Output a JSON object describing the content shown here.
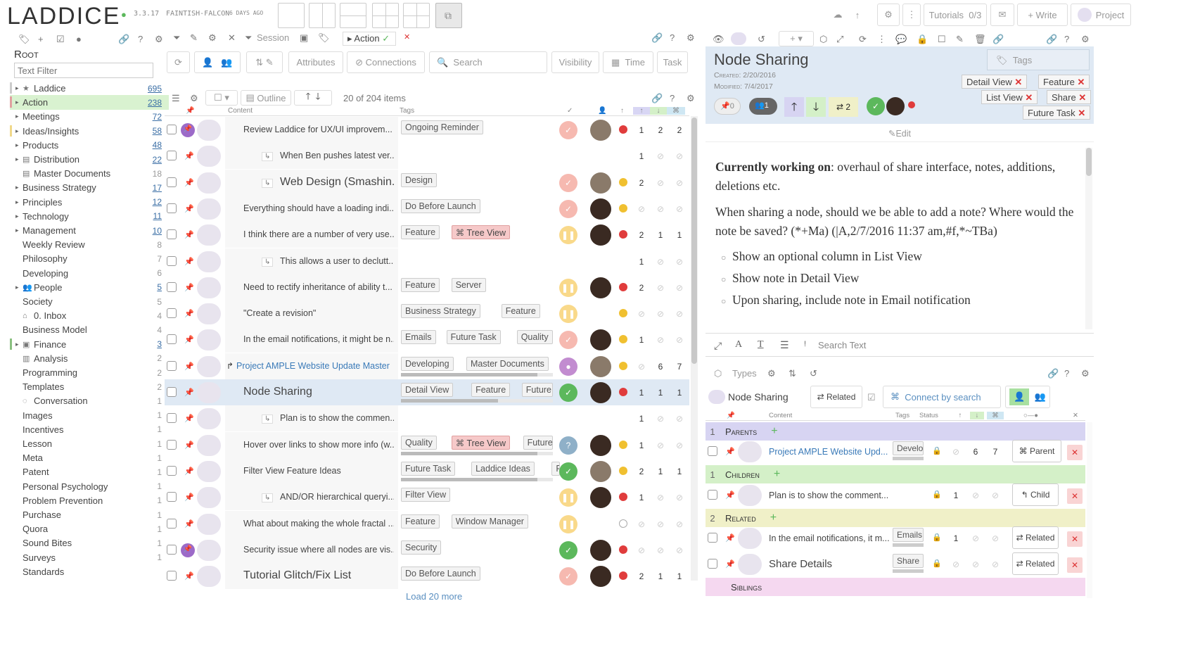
{
  "app": {
    "logo": "LADDICE",
    "version": "3.3.17",
    "codename": "FAINTISH-FALCON",
    "age": "6 DAYS AGO"
  },
  "topright": {
    "tutorials": "Tutorials",
    "tutorials_count": "0/3",
    "write": "Write",
    "project": "Project"
  },
  "left": {
    "root": "Root",
    "filter_placeholder": "Text Filter",
    "items": [
      {
        "label": "Laddice",
        "count": "695",
        "u": true,
        "icon": "star"
      },
      {
        "label": "Action",
        "count": "238",
        "u": true
      },
      {
        "label": "Meetings",
        "count": "72",
        "u": true
      },
      {
        "label": "Ideas/Insights",
        "count": "58",
        "u": true
      },
      {
        "label": "Products",
        "count": "48",
        "u": true
      },
      {
        "label": "Distribution",
        "count": "22",
        "u": true,
        "icon": "doc"
      },
      {
        "label": "Master Documents",
        "count": "18",
        "u": false,
        "icon": "doc"
      },
      {
        "label": "Business Strategy",
        "count": "17",
        "u": true
      },
      {
        "label": "Principles",
        "count": "12",
        "u": true
      },
      {
        "label": "Technology",
        "count": "11",
        "u": true
      },
      {
        "label": "Management",
        "count": "10",
        "u": true
      },
      {
        "label": "Weekly Review",
        "count": "8",
        "u": false
      },
      {
        "label": "Philosophy",
        "count": "7",
        "u": false
      },
      {
        "label": "Developing",
        "count": "6",
        "u": false
      },
      {
        "label": "People",
        "count": "5",
        "u": true,
        "icon": "people"
      },
      {
        "label": "Society",
        "count": "5",
        "u": false
      },
      {
        "label": "0. Inbox",
        "count": "4",
        "u": false,
        "icon": "inbox"
      },
      {
        "label": "Business Model",
        "count": "4",
        "u": false
      },
      {
        "label": "Finance",
        "count": "3",
        "u": true,
        "icon": "money"
      },
      {
        "label": "Analysis",
        "count": "2",
        "u": false,
        "icon": "chart"
      },
      {
        "label": "Programming",
        "count": "2",
        "u": false
      },
      {
        "label": "Templates",
        "count": "2",
        "u": false
      },
      {
        "label": "Conversation",
        "count": "1",
        "u": false,
        "icon": "chat"
      },
      {
        "label": "Images",
        "count": "1",
        "u": false
      },
      {
        "label": "Incentives",
        "count": "1",
        "u": false
      },
      {
        "label": "Lesson",
        "count": "1",
        "u": false
      },
      {
        "label": "Meta",
        "count": "1",
        "u": false
      },
      {
        "label": "Patent",
        "count": "1",
        "u": false
      },
      {
        "label": "Personal Psychology",
        "count": "1",
        "u": false
      },
      {
        "label": "Problem Prevention",
        "count": "1",
        "u": false
      },
      {
        "label": "Purchase",
        "count": "1",
        "u": false
      },
      {
        "label": "Quora",
        "count": "1",
        "u": false
      },
      {
        "label": "Sound Bites",
        "count": "1",
        "u": false
      },
      {
        "label": "Surveys",
        "count": "1",
        "u": false
      },
      {
        "label": "Standards",
        "count": "",
        "u": false
      }
    ]
  },
  "mid": {
    "session": "Session",
    "action_tab": "Action",
    "attributes": "Attributes",
    "connections": "Connections",
    "search": "Search",
    "visibility": "Visibility",
    "time": "Time",
    "task": "Task",
    "outline": "Outline",
    "items_count": "20 of 204 items",
    "col_content": "Content",
    "col_tags": "Tags",
    "load_more": "Load 20 more",
    "rows": [
      {
        "title": "Review Laddice for UX/UI improvem...",
        "indent": 0,
        "tags": [
          "Ongoing Reminder"
        ],
        "status": "red",
        "av": "light",
        "dot": "#e03c3c",
        "n": [
          "1",
          "2",
          "2"
        ],
        "pin": true
      },
      {
        "title": "When Ben pushes latest ver...",
        "indent": 1,
        "tags": [],
        "status": "",
        "av": "",
        "dot": "",
        "n": [
          "1",
          "",
          ""
        ]
      },
      {
        "title": "Web Design (Smashin...",
        "indent": 1,
        "big": true,
        "tags": [
          "Design"
        ],
        "status": "red",
        "av": "light",
        "dot": "#f0c030",
        "n": [
          "2",
          "",
          ""
        ]
      },
      {
        "title": "Everything should have a loading indi...",
        "indent": 0,
        "tags": [
          "Do Before Launch"
        ],
        "status": "red",
        "av": "dark",
        "dot": "#f0c030",
        "n": [
          "",
          "",
          ""
        ]
      },
      {
        "title": "I think there are a number of very use...",
        "indent": 0,
        "tags": [
          "Feature",
          "Tree View"
        ],
        "status": "yellow",
        "av": "dark",
        "dot": "#e03c3c",
        "n": [
          "2",
          "1",
          "1"
        ]
      },
      {
        "title": "This allows a user to declutt...",
        "indent": 1,
        "tags": [],
        "status": "",
        "av": "",
        "dot": "",
        "n": [
          "1",
          "",
          ""
        ]
      },
      {
        "title": "Need to rectify inheritance of ability t...",
        "indent": 0,
        "tags": [
          "Feature",
          "Server"
        ],
        "status": "yellow",
        "av": "dark",
        "dot": "#e03c3c",
        "n": [
          "2",
          "",
          ""
        ]
      },
      {
        "title": "\"Create a revision\"",
        "indent": 0,
        "tags": [
          "Business Strategy",
          "Feature"
        ],
        "status": "yellow",
        "av": "",
        "dot": "#f0c030",
        "n": [
          "",
          "",
          ""
        ]
      },
      {
        "title": "In the email notifications, it might be n...",
        "indent": 0,
        "tags": [
          "Emails",
          "Future Task",
          "Quality"
        ],
        "status": "red",
        "av": "dark",
        "dot": "#f0c030",
        "n": [
          "1",
          "",
          ""
        ]
      },
      {
        "title": "Project AMPLE Website Update Master",
        "indent": 0,
        "link": true,
        "tags": [
          "Developing",
          "Master Documents"
        ],
        "status": "purple",
        "av": "light",
        "dot": "#f0c030",
        "n": [
          "",
          "6",
          "7"
        ]
      },
      {
        "title": "Node Sharing",
        "indent": 0,
        "big": true,
        "sel": true,
        "tags": [
          "Detail View",
          "Feature",
          "Future Task"
        ],
        "status": "green",
        "av": "dark",
        "dot": "#e03c3c",
        "n": [
          "1",
          "1",
          "1"
        ]
      },
      {
        "title": "Plan is to show the commen...",
        "indent": 1,
        "tags": [],
        "status": "",
        "av": "",
        "dot": "",
        "n": [
          "1",
          "",
          ""
        ]
      },
      {
        "title": "Hover over links to show more info (w...",
        "indent": 0,
        "tags": [
          "Quality",
          "Tree View",
          "Future Task"
        ],
        "status": "blue",
        "av": "dark",
        "dot": "#f0c030",
        "n": [
          "1",
          "",
          ""
        ]
      },
      {
        "title": "Filter View Feature Ideas",
        "indent": 0,
        "tags": [
          "Future Task",
          "Laddice Ideas",
          "Filter V"
        ],
        "status": "green",
        "av": "light",
        "dot": "#f0c030",
        "n": [
          "2",
          "1",
          "1"
        ]
      },
      {
        "title": "AND/OR hierarchical queryi...",
        "indent": 1,
        "tags": [
          "Filter View"
        ],
        "status": "yellow",
        "av": "dark",
        "dot": "#e03c3c",
        "n": [
          "1",
          "",
          ""
        ]
      },
      {
        "title": "What about making the whole fractal ...",
        "indent": 0,
        "tags": [
          "Feature",
          "Window Manager"
        ],
        "status": "yellow",
        "av": "",
        "dot": "empty",
        "n": [
          "",
          "",
          ""
        ]
      },
      {
        "title": "Security issue where all nodes are vis...",
        "indent": 0,
        "tags": [
          "Security"
        ],
        "status": "green",
        "av": "dark",
        "dot": "#e03c3c",
        "n": [
          "",
          "",
          ""
        ],
        "pin": true
      },
      {
        "title": "Tutorial Glitch/Fix List",
        "indent": 0,
        "big": true,
        "tags": [
          "Do Before Launch"
        ],
        "status": "red",
        "av": "dark",
        "dot": "#e03c3c",
        "n": [
          "2",
          "1",
          "1"
        ]
      }
    ]
  },
  "detail": {
    "title": "Node Sharing",
    "created": "Created: 2/20/2016",
    "modified": "Modified: 7/4/2017",
    "tags_label": "Tags",
    "tags": [
      "Detail View",
      "Feature",
      "List View",
      "Share",
      "Future Task"
    ],
    "pin_count": "0",
    "people_count": "1",
    "related_count": "2",
    "edit": "Edit",
    "p1_bold": "Currently working on",
    "p1_rest": ": overhaul of share interface, notes, additions, deletions etc.",
    "p2": "When sharing a node, should we be able to add a note? Where would the note be saved? (*+Ma) (|A,2/7/2016 11:37 am,#f,*~TBa)",
    "bullets": [
      "Show an optional column in List View",
      "Show note in Detail View",
      "Upon sharing, include note in Email notification"
    ],
    "search_text": "Search Text"
  },
  "conn": {
    "types": "Types",
    "node": "Node Sharing",
    "related_btn": "Related",
    "connect_search": "Connect by search",
    "col_content": "Content",
    "col_tags": "Tags",
    "col_status": "Status",
    "parents": {
      "n": "1",
      "label": "Parents"
    },
    "children": {
      "n": "1",
      "label": "Children"
    },
    "related": {
      "n": "2",
      "label": "Related"
    },
    "siblings": {
      "label": "Siblings"
    },
    "rows": [
      {
        "title": "Project AMPLE Website Upd...",
        "tag": "Develo",
        "n": [
          "",
          "6",
          "7"
        ],
        "btn": "Parent",
        "link": true
      },
      {
        "title": "Plan is to show the comment...",
        "tag": "",
        "n": [
          "1",
          "",
          ""
        ],
        "btn": "Child"
      },
      {
        "title": "In the email notifications, it m...",
        "tag": "Emails",
        "n": [
          "1",
          "",
          ""
        ],
        "btn": "Related"
      },
      {
        "title": "Share Details",
        "tag": "Share",
        "n": [
          "",
          "",
          ""
        ],
        "btn": "Related",
        "big": true
      }
    ]
  },
  "colors": {
    "accent": "#4caf50",
    "green": "#5cb85c",
    "purple": "#d7d4f2",
    "children_bg": "#d4f0c8",
    "related_bg": "#f0f0c8",
    "siblings_bg": "#f5d8f0"
  }
}
